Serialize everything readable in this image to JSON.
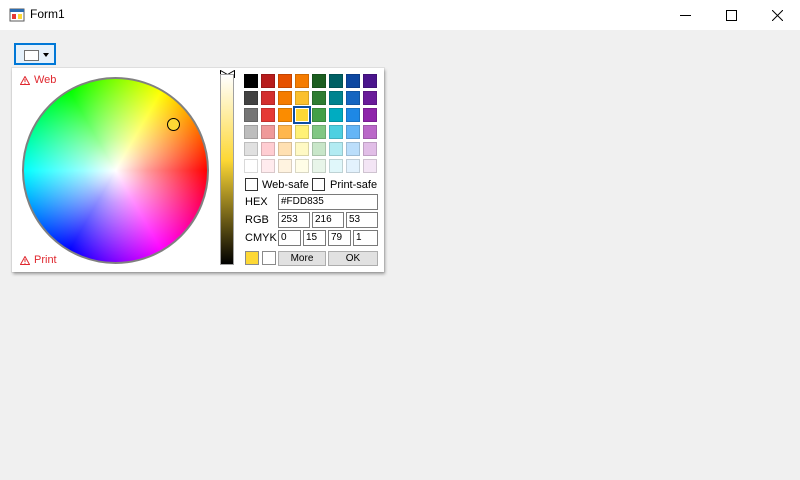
{
  "window": {
    "title": "Form1"
  },
  "color_picker": {
    "warnings": {
      "web": "Web",
      "print": "Print"
    },
    "palette": [
      [
        "#000000",
        "#b71c1c",
        "#e65100",
        "#f57c00",
        "#1b5e20",
        "#006064",
        "#0d47a1",
        "#4a148c"
      ],
      [
        "#424242",
        "#d32f2f",
        "#f57c00",
        "#fbc02d",
        "#2e7d32",
        "#00838f",
        "#1565c0",
        "#6a1b9a"
      ],
      [
        "#757575",
        "#e53935",
        "#fb8c00",
        "#fdd835",
        "#43a047",
        "#00acc1",
        "#1e88e5",
        "#8e24aa"
      ],
      [
        "#bdbdbd",
        "#ef9a9a",
        "#ffb74d",
        "#fff176",
        "#81c784",
        "#4dd0e1",
        "#64b5f6",
        "#ba68c8"
      ],
      [
        "#e0e0e0",
        "#ffcdd2",
        "#ffe0b2",
        "#fff9c4",
        "#c8e6c9",
        "#b2ebf2",
        "#bbdefb",
        "#e1bee7"
      ],
      [
        "#ffffff",
        "#ffebee",
        "#fff3e0",
        "#fffde7",
        "#e8f5e9",
        "#e0f7fa",
        "#e3f2fd",
        "#f3e5f5"
      ]
    ],
    "selected_swatch": "#fdd835",
    "web_safe": {
      "label": "Web-safe",
      "checked": false
    },
    "print_safe": {
      "label": "Print-safe",
      "checked": false
    },
    "hex": {
      "label": "HEX",
      "value": "#FDD835"
    },
    "rgb": {
      "label": "RGB",
      "r": "253",
      "g": "216",
      "b": "53"
    },
    "cmyk": {
      "label": "CMYK",
      "c": "0",
      "m": "15",
      "y": "79",
      "k": "1"
    },
    "new_color": "#fdd835",
    "old_color": "#ffffff",
    "more_label": "More",
    "ok_label": "OK"
  }
}
